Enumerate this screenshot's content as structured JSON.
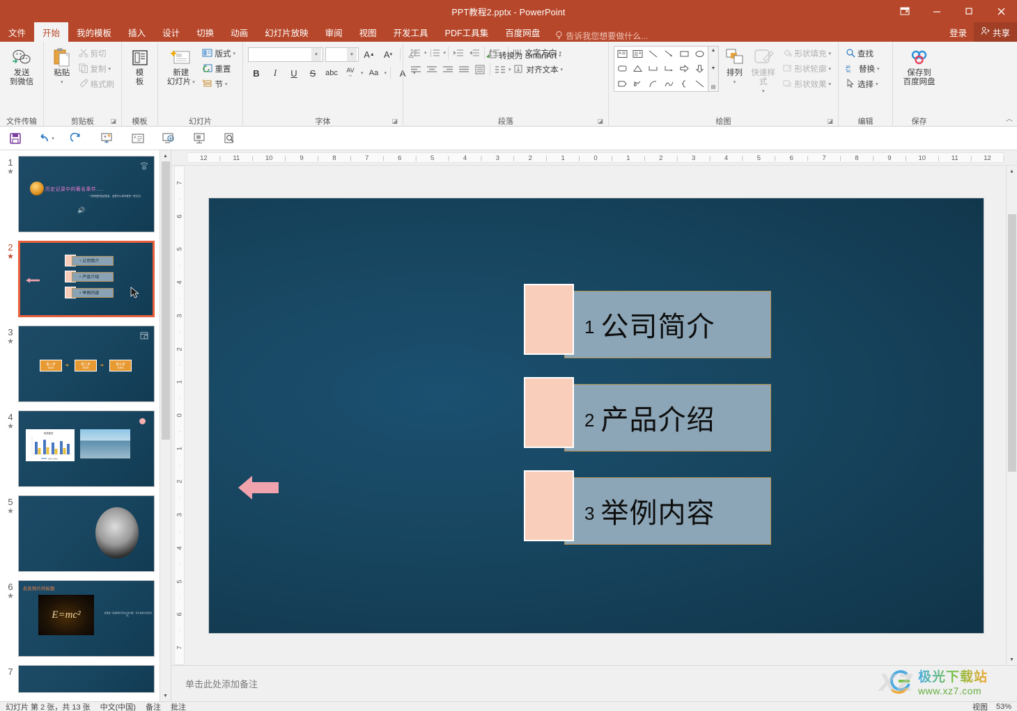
{
  "window": {
    "title": "PPT教程2.pptx - PowerPoint",
    "restore_icon": "restore-down-icon",
    "minimize_icon": "minimize-icon",
    "maximize_icon": "maximize-icon",
    "close_icon": "close-icon"
  },
  "tabs": [
    {
      "label": "文件",
      "active": false
    },
    {
      "label": "开始",
      "active": true
    },
    {
      "label": "我的模板",
      "active": false
    },
    {
      "label": "插入",
      "active": false
    },
    {
      "label": "设计",
      "active": false
    },
    {
      "label": "切换",
      "active": false
    },
    {
      "label": "动画",
      "active": false
    },
    {
      "label": "幻灯片放映",
      "active": false
    },
    {
      "label": "审阅",
      "active": false
    },
    {
      "label": "视图",
      "active": false
    },
    {
      "label": "开发工具",
      "active": false
    },
    {
      "label": "PDF工具集",
      "active": false
    },
    {
      "label": "百度网盘",
      "active": false
    }
  ],
  "tellme": {
    "placeholder": "告诉我您想要做什么...",
    "icon": "lightbulb-icon"
  },
  "account": {
    "login_label": "登录",
    "share_label": "共享",
    "share_icon": "person-share-icon"
  },
  "ribbon": {
    "groups": [
      {
        "name": "文件传输",
        "buttons": [
          {
            "label_line1": "发送",
            "label_line2": "到微信",
            "icon": "wechat-icon"
          }
        ]
      },
      {
        "name": "剪贴板",
        "paste": {
          "label": "粘贴",
          "icon": "paste-icon"
        },
        "items": [
          {
            "label": "剪切",
            "icon": "scissors-icon",
            "enabled": false
          },
          {
            "label": "复制",
            "icon": "copy-icon",
            "enabled": false,
            "has_caret": true
          },
          {
            "label": "格式刷",
            "icon": "format-painter-icon",
            "enabled": false
          }
        ],
        "dialog_launcher": true
      },
      {
        "name": "模板",
        "buttons": [
          {
            "label_line1": "模",
            "label_line2": "板",
            "icon": "template-icon"
          }
        ]
      },
      {
        "name": "幻灯片",
        "newslide": {
          "label_line1": "新建",
          "label_line2": "幻灯片",
          "icon": "new-slide-icon",
          "has_caret": true
        },
        "items": [
          {
            "label": "版式",
            "icon": "layout-icon",
            "has_caret": true
          },
          {
            "label": "重置",
            "icon": "reset-icon",
            "has_caret": false
          },
          {
            "label": "节",
            "icon": "section-icon",
            "has_caret": true
          }
        ]
      },
      {
        "name": "字体",
        "font_name_value": "",
        "font_size_value": "",
        "grow_font_icon": "grow-font-icon",
        "shrink_font_icon": "shrink-font-icon",
        "clear_format_icon": "clear-formatting-icon",
        "row2": [
          "B",
          "I",
          "U",
          "S",
          "abc",
          "AV",
          "Aa",
          "A"
        ],
        "dialog_launcher": true
      },
      {
        "name": "段落",
        "text_direction": {
          "label": "文字方向",
          "icon": "text-direction-icon"
        },
        "align_text": {
          "label": "对齐文本",
          "icon": "align-text-icon"
        },
        "smartart": {
          "label": "转换为 SmartArt",
          "icon": "smartart-icon"
        },
        "dialog_launcher": true
      },
      {
        "name": "绘图",
        "arrange": {
          "label": "排列",
          "icon": "arrange-icon",
          "has_caret": true
        },
        "quickstyles": {
          "label_line1": "快速样式",
          "icon": "quick-styles-icon"
        },
        "items": [
          {
            "label": "形状填充",
            "icon": "shape-fill-icon"
          },
          {
            "label": "形状轮廓",
            "icon": "shape-outline-icon"
          },
          {
            "label": "形状效果",
            "icon": "shape-effects-icon"
          }
        ]
      },
      {
        "name": "编辑",
        "items": [
          {
            "label": "查找",
            "icon": "search-icon"
          },
          {
            "label": "替换",
            "icon": "replace-icon",
            "has_caret": true
          },
          {
            "label": "选择",
            "icon": "select-icon",
            "has_caret": true
          }
        ]
      },
      {
        "name": "保存",
        "buttons": [
          {
            "label_line1": "保存到",
            "label_line2": "百度网盘",
            "icon": "baidu-netdisk-icon"
          }
        ]
      }
    ],
    "collapse_icon": "collapse-ribbon-icon"
  },
  "quick_access": [
    {
      "name": "save-icon"
    },
    {
      "name": "undo-icon",
      "has_caret": true
    },
    {
      "name": "redo-icon"
    },
    {
      "name": "start-from-beginning-icon"
    },
    {
      "name": "new-slide-qat-icon"
    },
    {
      "name": "slideshow-icon"
    },
    {
      "name": "presenter-view-icon"
    },
    {
      "name": "print-preview-icon"
    }
  ],
  "thumbnails": {
    "scroll_up_icon": "scroll-up-icon",
    "scroll_down_icon": "scroll-down-icon",
    "slides": [
      {
        "number": "1",
        "star": "★",
        "selected": false,
        "type": "title",
        "title": "历史记录中的著名事件",
        "title_suffix": "......",
        "subtitle": "一些简短的描述信息，这里可以填写更多一些文字。"
      },
      {
        "number": "2",
        "star": "★",
        "selected": true,
        "type": "agenda",
        "items": [
          {
            "num": "1",
            "text": "公司简介"
          },
          {
            "num": "2",
            "text": "产品介绍"
          },
          {
            "num": "3",
            "text": "举例内容"
          }
        ]
      },
      {
        "number": "3",
        "star": "★",
        "selected": false,
        "type": "steps",
        "steps": [
          {
            "title": "第一步",
            "sub": "XXX"
          },
          {
            "title": "第二步",
            "sub": "XXX"
          },
          {
            "title": "第三步",
            "sub": "XXX"
          }
        ]
      },
      {
        "number": "4",
        "star": "★",
        "selected": false,
        "type": "chart-image"
      },
      {
        "number": "5",
        "star": "★",
        "selected": false,
        "type": "portrait"
      },
      {
        "number": "6",
        "star": "★",
        "selected": false,
        "type": "photo-title",
        "title": "此处照片的标题",
        "equation": "E=mc²",
        "body": "这里是一段说明文字的占位内容，可以替换为实际文字。"
      },
      {
        "number": "7",
        "star": "",
        "selected": false,
        "type": "blank"
      }
    ]
  },
  "ruler": {
    "horizontal_left": [
      "12",
      "11",
      "10",
      "9",
      "8",
      "7",
      "6",
      "5",
      "4",
      "3",
      "2",
      "1"
    ],
    "horizontal_center": "0",
    "horizontal_right": [
      "1",
      "2",
      "3",
      "4",
      "5",
      "6",
      "7",
      "8",
      "9",
      "10",
      "11",
      "12"
    ],
    "vertical_top": [
      "7",
      "6",
      "5",
      "4",
      "3",
      "2",
      "1"
    ],
    "vertical_center": "0",
    "vertical_bottom": [
      "1",
      "2",
      "3",
      "4",
      "5",
      "6",
      "7"
    ]
  },
  "slide": {
    "agenda_items": [
      {
        "num": "1",
        "text": "公司简介"
      },
      {
        "num": "2",
        "text": "产品介绍"
      },
      {
        "num": "3",
        "text": "举例内容"
      }
    ],
    "arrow": "left-arrow-shape",
    "colors": {
      "background_dark": "#103449",
      "background_light": "#1b5070",
      "bar_fill": "#8CA6B7",
      "bar_border": "#B5904F",
      "accent_pink": "#F9CFBC",
      "arrow_pink": "#F0A3AC"
    }
  },
  "notes": {
    "placeholder": "单击此处添加备注"
  },
  "status": {
    "left": [
      "幻灯片 第 2 张，共 13 张",
      "中文(中国)",
      "备注",
      "批注"
    ],
    "right": [
      "视图",
      "53%"
    ]
  },
  "watermark": {
    "cn": "极光下载站",
    "en": "www.xz7.com",
    "ghost": "xz"
  }
}
